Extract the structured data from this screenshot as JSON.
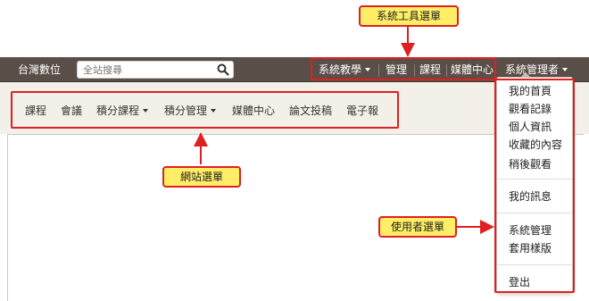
{
  "topbar": {
    "brand": "台灣數位",
    "search": {
      "placeholder": "全站搜尋",
      "icon": "search-icon"
    },
    "items": [
      {
        "label": "系統教學",
        "has_caret": true
      },
      {
        "label": "管理"
      },
      {
        "label": "課程"
      },
      {
        "label": "媒體中心"
      },
      {
        "label": "系統管理者",
        "has_caret": true
      }
    ]
  },
  "site_menu": {
    "items": [
      {
        "label": "課程"
      },
      {
        "label": "會議"
      },
      {
        "label": "積分課程",
        "has_caret": true
      },
      {
        "label": "積分管理",
        "has_caret": true
      },
      {
        "label": "媒體中心"
      },
      {
        "label": "論文投稿"
      },
      {
        "label": "電子報"
      }
    ]
  },
  "user_menu": {
    "items": [
      {
        "label": "我的首頁"
      },
      {
        "label": "觀看記錄"
      },
      {
        "label": "個人資訊"
      },
      {
        "label": "收藏的內容"
      },
      {
        "label": "稍後觀看"
      },
      {
        "label": "我的訊息"
      },
      {
        "label": "系統管理"
      },
      {
        "label": "套用樣版"
      },
      {
        "label": "登出"
      }
    ]
  },
  "callouts": {
    "system_tools": "系統工具選單",
    "site_menu": "網站選單",
    "user_menu": "使用者選單"
  },
  "colors": {
    "topbar": "#5a4e48",
    "highlight": "#e02020",
    "callout_bg": "#ffee66",
    "site_menu_bg": "#f3efe9"
  }
}
